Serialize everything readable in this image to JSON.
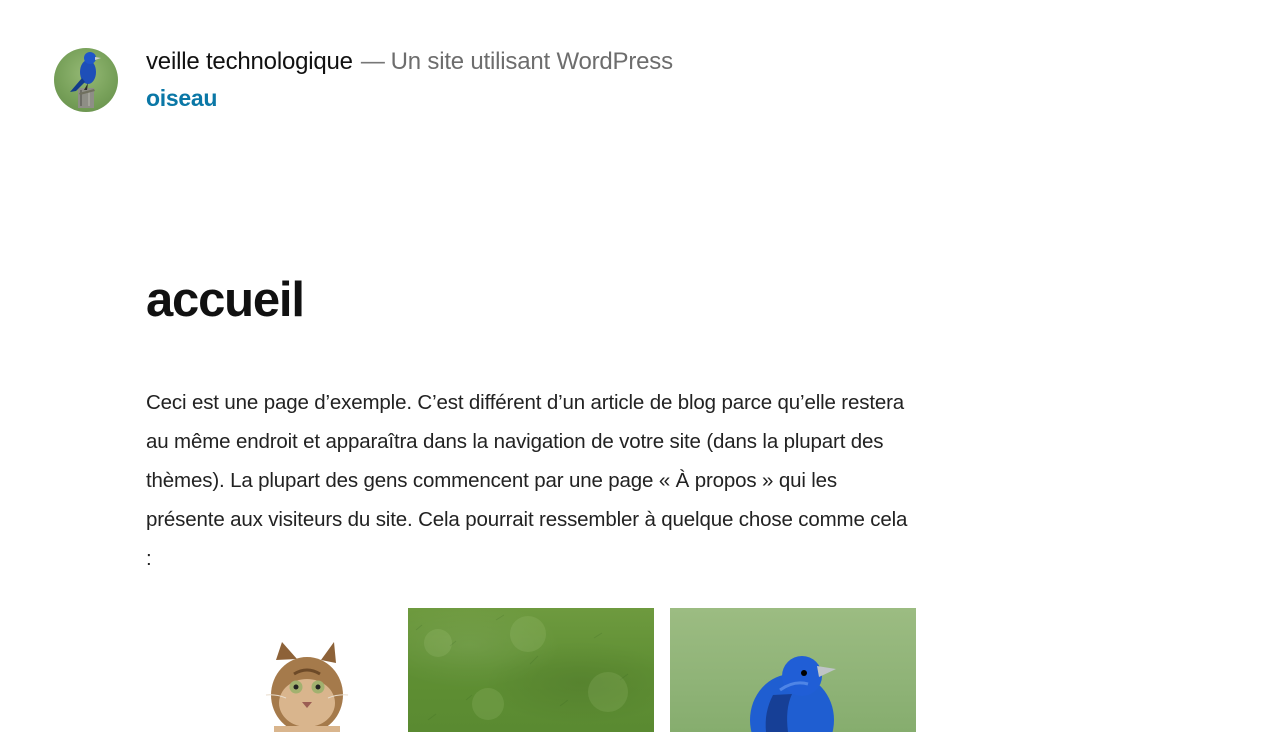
{
  "header": {
    "site_title": "veille technologique",
    "separator": "—",
    "site_description": "Un site utilisant WordPress",
    "nav_link": "oiseau",
    "logo_icon": "bird-logo-icon"
  },
  "page": {
    "title": "accueil",
    "content": "Ceci est une page d’exemple. C’est différent d’un article de blog parce qu’elle restera au même endroit et apparaîtra dans la navigation de votre site (dans la plupart des thèmes). La plupart des gens commencent par une page « À propos » qui les présente aux visiteurs du site. Cela pourrait ressembler à quelque chose comme cela :"
  },
  "gallery": {
    "items": [
      {
        "icon": "cat-image"
      },
      {
        "icon": "grass-image"
      },
      {
        "icon": "bird-image"
      }
    ]
  },
  "colors": {
    "link": "#0a77a6",
    "text": "#111111",
    "muted": "#6d6d6d"
  }
}
